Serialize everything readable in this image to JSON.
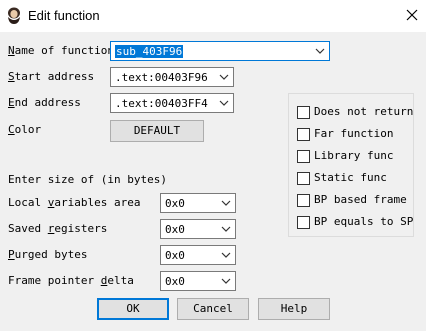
{
  "window": {
    "title": "Edit function",
    "app_icon": "ida-icon",
    "close_icon": "close-icon"
  },
  "fields": {
    "name_label_u": "N",
    "name_label_rest": "ame of function",
    "name_value": "sub_403F96",
    "start_label_u": "S",
    "start_label_rest": "tart address",
    "start_value": ".text:00403F96",
    "end_label_u": "E",
    "end_label_rest": "nd address",
    "end_value": ".text:00403FF4",
    "color_label_u": "C",
    "color_label_rest": "olor",
    "color_button": "DEFAULT"
  },
  "sizes": {
    "heading": "Enter size of (in bytes)",
    "local_label_pre": "Local ",
    "local_label_u": "v",
    "local_label_rest": "ariables area",
    "local_value": "0x0",
    "saved_label_pre": "Saved ",
    "saved_label_u": "r",
    "saved_label_rest": "egisters",
    "saved_value": "0x0",
    "purged_label_u": "P",
    "purged_label_rest": "urged bytes",
    "purged_value": "0x0",
    "frame_label_pre": "Frame pointer ",
    "frame_label_u": "d",
    "frame_label_rest": "elta",
    "frame_value": "0x0"
  },
  "flags": [
    {
      "label": "Does not return",
      "checked": false
    },
    {
      "label": "Far function",
      "checked": false
    },
    {
      "label": "Library func",
      "checked": false
    },
    {
      "label": "Static func",
      "checked": false
    },
    {
      "label": "BP based frame",
      "checked": false
    },
    {
      "label": "BP equals to SP",
      "checked": false
    }
  ],
  "buttons": {
    "ok": "OK",
    "cancel": "Cancel",
    "help": "Help"
  },
  "colors": {
    "accent": "#0078d7",
    "background": "#f0f0f0"
  }
}
